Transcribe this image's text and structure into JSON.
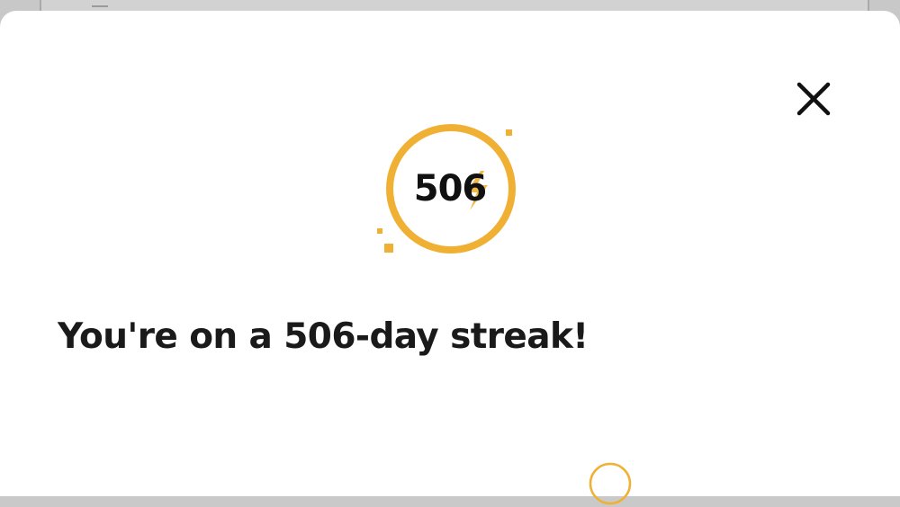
{
  "colors": {
    "accent": "#f0b034",
    "text": "#1a1a1a",
    "sheet": "#ffffff",
    "backdrop": "#c8c8c8"
  },
  "dialog": {
    "close_icon": "close-icon",
    "streak_badge": {
      "count": "506",
      "icon": "lightning-bolt-icon"
    },
    "headline": "You're on a 506-day streak!"
  }
}
